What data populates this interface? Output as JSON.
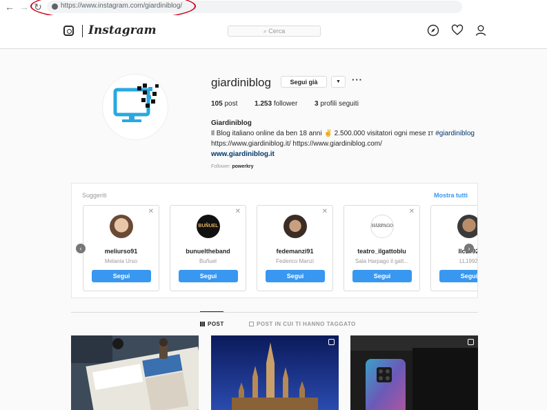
{
  "browser": {
    "back_icon": "arrow-left-icon",
    "forward_icon": "arrow-right-icon",
    "reload_icon": "reload-icon",
    "url": "https://www.instagram.com/giardiniblog/"
  },
  "header": {
    "brand": "Instagram",
    "search_placeholder": "Cerca",
    "icons": [
      "instagram-icon",
      "explore-compass-icon",
      "heart-icon",
      "profile-icon"
    ]
  },
  "profile": {
    "username": "giardiniblog",
    "follow_button": "Segui già",
    "more": "···",
    "stats": {
      "posts_value": "105",
      "posts_label": "post",
      "followers_value": "1.253",
      "followers_label": "follower",
      "following_value": "3",
      "following_label": "profili seguiti"
    },
    "bio": {
      "name": "Giardiniblog",
      "line1": "Il Blog italiano online da ben 18 anni ✌ 2.500.000 visitatori ogni mese ɪᴛ",
      "hashtag": "#giardiniblog",
      "line2": "https://www.giardiniblog.it/ https://www.giardiniblog.com/",
      "website": "www.giardiniblog.it"
    },
    "followed_by_label": "Follower:",
    "followed_by_user": "powerkry"
  },
  "suggestions": {
    "title": "Suggeriti",
    "show_all": "Mostra tutti",
    "close_glyph": "✕",
    "follow_label": "Segui",
    "cards": [
      {
        "username": "meliurso91",
        "name": "Melania Urso",
        "avatar_color": "#c9a27e"
      },
      {
        "username": "bunueltheband",
        "name": "Buñuel",
        "avatar_color": "#111111",
        "avatar_text": "BUÑUEL"
      },
      {
        "username": "fedemanzi91",
        "name": "Federico Manzi",
        "avatar_color": "#5a4636"
      },
      {
        "username": "teatro_ilgattoblu",
        "name": "Sala Harpago il gatt...",
        "avatar_color": "#ffffff",
        "avatar_text": "HÁRPAGO"
      },
      {
        "username": "llc1992",
        "name": "LL1992",
        "avatar_color": "#6b5a48"
      }
    ]
  },
  "tabs": {
    "posts": "POST",
    "tagged": "POST IN CUI TI HANNO TAGGATO"
  },
  "colors": {
    "accent": "#3897f0",
    "link": "#003569",
    "highlight": "#d0021b"
  }
}
